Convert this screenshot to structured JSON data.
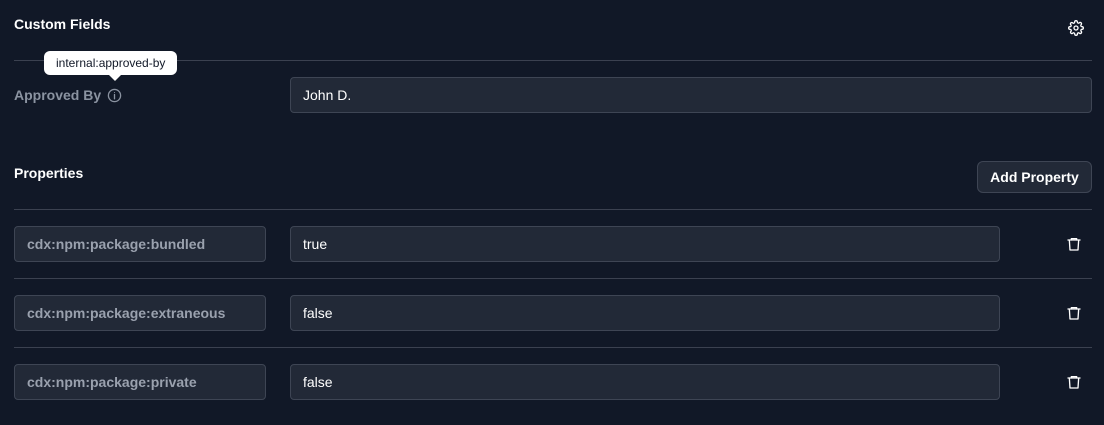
{
  "custom_fields": {
    "title": "Custom Fields",
    "settings_icon": "gear-icon",
    "approved_by": {
      "label": "Approved By",
      "tooltip": "internal:approved-by",
      "value": "John D."
    }
  },
  "properties": {
    "title": "Properties",
    "add_label": "Add Property",
    "rows": [
      {
        "key": "cdx:npm:package:bundled",
        "value": "true"
      },
      {
        "key": "cdx:npm:package:extraneous",
        "value": "false"
      },
      {
        "key": "cdx:npm:package:private",
        "value": "false"
      }
    ]
  },
  "colors": {
    "background": "#111827",
    "input_background": "#222937",
    "border": "#3e4554",
    "muted_text": "#8b93a1"
  }
}
